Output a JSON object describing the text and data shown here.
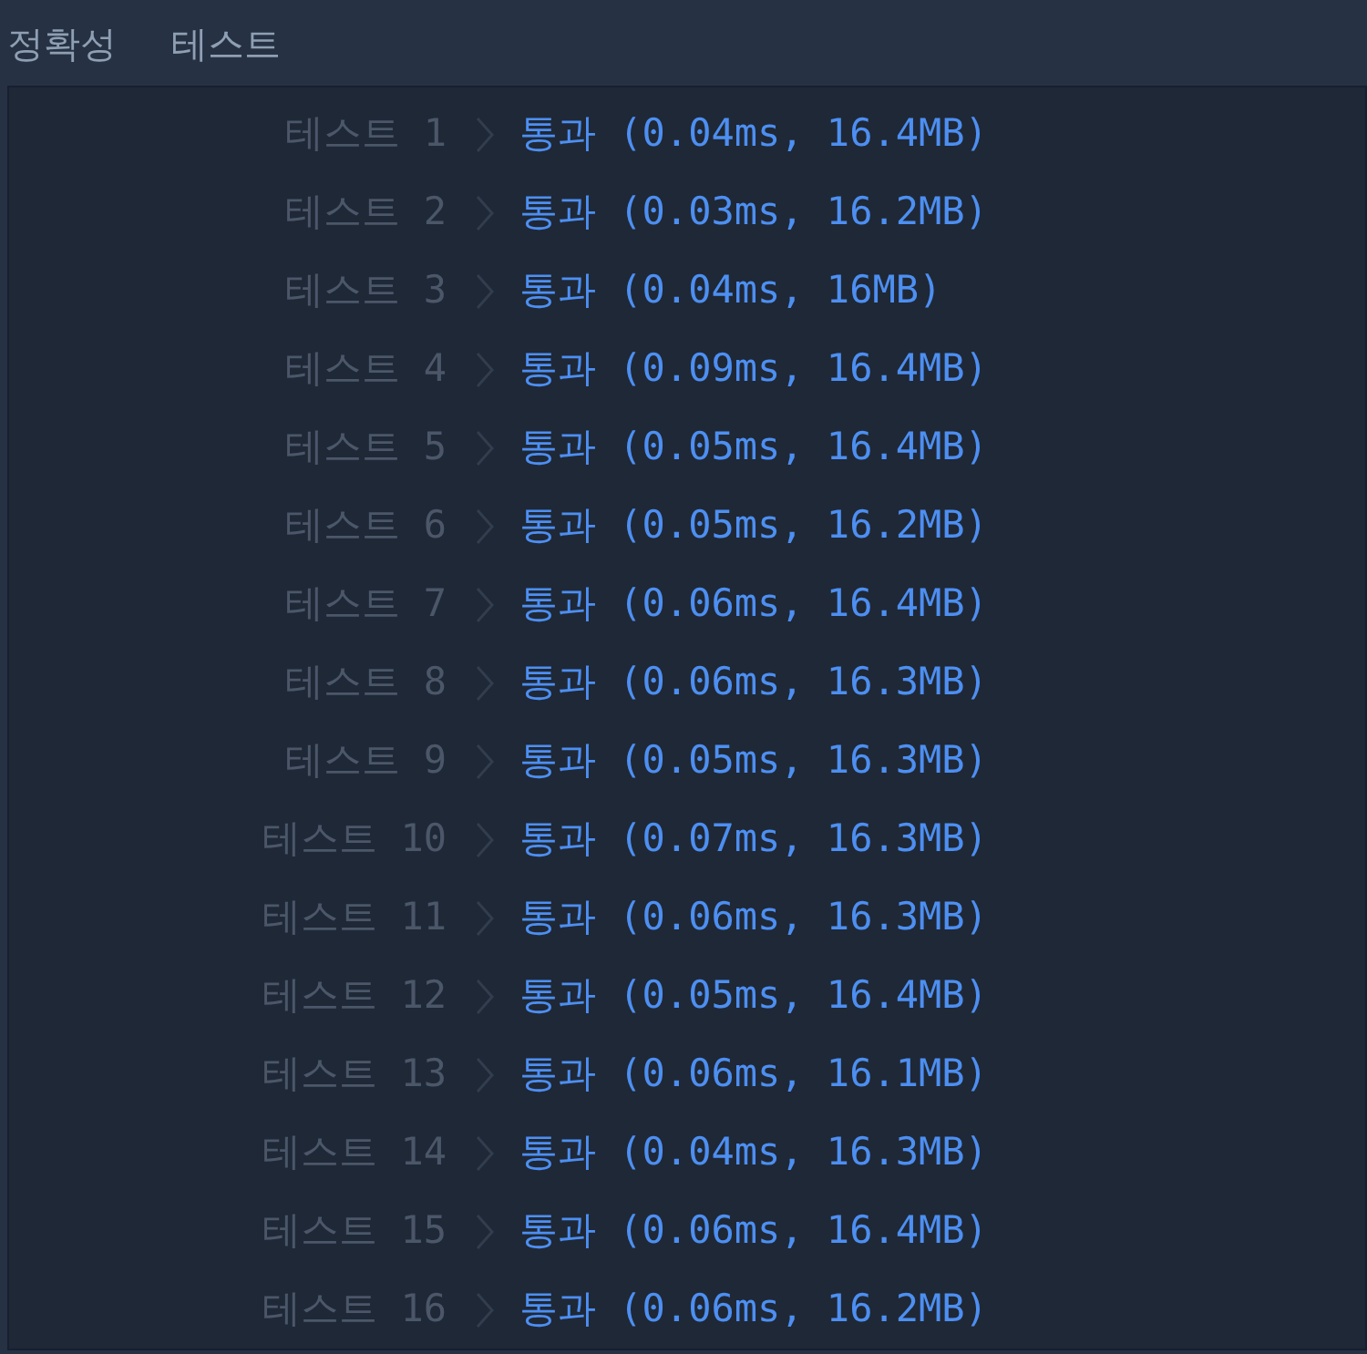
{
  "header": {
    "title": "정확성",
    "subtitle": "테스트"
  },
  "tests": [
    {
      "label": "테스트 1",
      "result": "통과 (0.04ms, 16.4MB)"
    },
    {
      "label": "테스트 2",
      "result": "통과 (0.03ms, 16.2MB)"
    },
    {
      "label": "테스트 3",
      "result": "통과 (0.04ms, 16MB)"
    },
    {
      "label": "테스트 4",
      "result": "통과 (0.09ms, 16.4MB)"
    },
    {
      "label": "테스트 5",
      "result": "통과 (0.05ms, 16.4MB)"
    },
    {
      "label": "테스트 6",
      "result": "통과 (0.05ms, 16.2MB)"
    },
    {
      "label": "테스트 7",
      "result": "통과 (0.06ms, 16.4MB)"
    },
    {
      "label": "테스트 8",
      "result": "통과 (0.06ms, 16.3MB)"
    },
    {
      "label": "테스트 9",
      "result": "통과 (0.05ms, 16.3MB)"
    },
    {
      "label": "테스트 10",
      "result": "통과 (0.07ms, 16.3MB)"
    },
    {
      "label": "테스트 11",
      "result": "통과 (0.06ms, 16.3MB)"
    },
    {
      "label": "테스트 12",
      "result": "통과 (0.05ms, 16.4MB)"
    },
    {
      "label": "테스트 13",
      "result": "통과 (0.06ms, 16.1MB)"
    },
    {
      "label": "테스트 14",
      "result": "통과 (0.04ms, 16.3MB)"
    },
    {
      "label": "테스트 15",
      "result": "통과 (0.06ms, 16.4MB)"
    },
    {
      "label": "테스트 16",
      "result": "통과 (0.06ms, 16.2MB)"
    }
  ]
}
